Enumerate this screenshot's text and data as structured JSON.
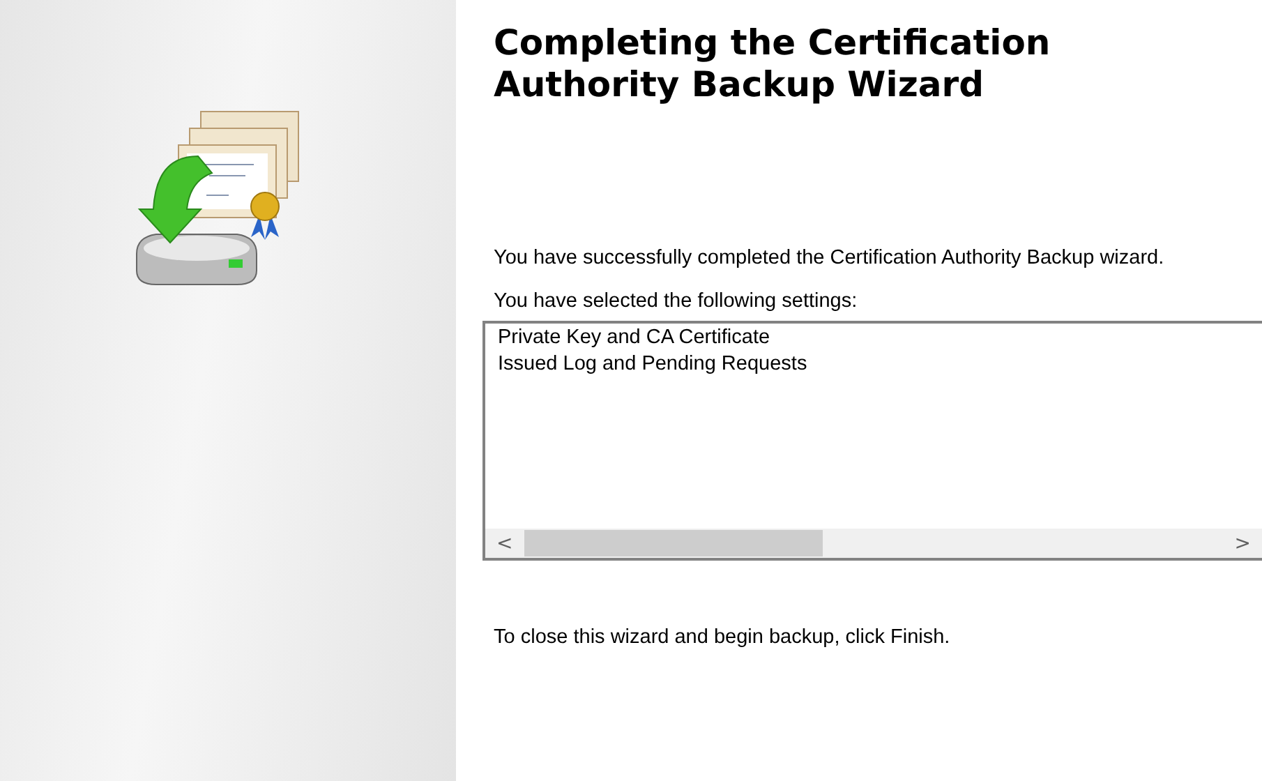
{
  "title": "Completing the Certification Authority Backup Wizard",
  "intro": "You have successfully completed the Certification Authority Backup wizard.",
  "settings_label": "You have selected the following settings:",
  "settings": [
    "Private Key and CA Certificate",
    "Issued Log and Pending Requests"
  ],
  "scroll_left": "<",
  "scroll_right": ">",
  "footer": "To close this wizard and begin backup, click Finish."
}
